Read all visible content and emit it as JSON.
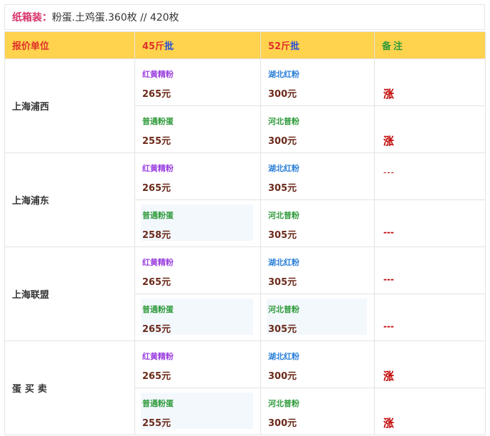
{
  "top": {
    "label": "纸箱装：",
    "text": "粉蛋.土鸡蛋.360枚 // 420枚"
  },
  "headers": {
    "unit": "报价单位",
    "c45_num": "45斤",
    "c45_lb": "批",
    "c52_num": "52斤",
    "c52_lb": "批",
    "note": "备注"
  },
  "rows": [
    {
      "unit": "上海浦西",
      "a": [
        {
          "name": "红黄精粉",
          "price": "265元"
        },
        {
          "name": "普通粉蛋",
          "price": "255元"
        }
      ],
      "b": [
        {
          "name": "湖北红粉",
          "price": "300元"
        },
        {
          "name": "河北普粉",
          "price": "300元"
        }
      ],
      "notes": [
        "涨",
        "涨"
      ]
    },
    {
      "unit": "上海浦东",
      "a": [
        {
          "name": "红黄精粉",
          "price": "265元"
        },
        {
          "name": "普通粉蛋",
          "price": "258元"
        }
      ],
      "b": [
        {
          "name": "湖北红粉",
          "price": "305元"
        },
        {
          "name": "河北普粉",
          "price": "305元"
        }
      ],
      "notes": [
        "---",
        "---"
      ]
    },
    {
      "unit": "上海联盟",
      "a": [
        {
          "name": "红黄精粉",
          "price": "265元"
        },
        {
          "name": "普通粉蛋",
          "price": "265元"
        }
      ],
      "b": [
        {
          "name": "湖北红粉",
          "price": "305元"
        },
        {
          "name": "河北普粉",
          "price": "305元"
        }
      ],
      "notes": [
        "---",
        "---"
      ]
    },
    {
      "unit": "蛋买卖",
      "a": [
        {
          "name": "红黄精粉",
          "price": "265元"
        },
        {
          "name": "普通粉蛋",
          "price": "255元"
        }
      ],
      "b": [
        {
          "name": "湖北红粉",
          "price": "300元"
        },
        {
          "name": "河北普粉",
          "price": "300元"
        }
      ],
      "notes": [
        "涨",
        "涨"
      ]
    }
  ]
}
